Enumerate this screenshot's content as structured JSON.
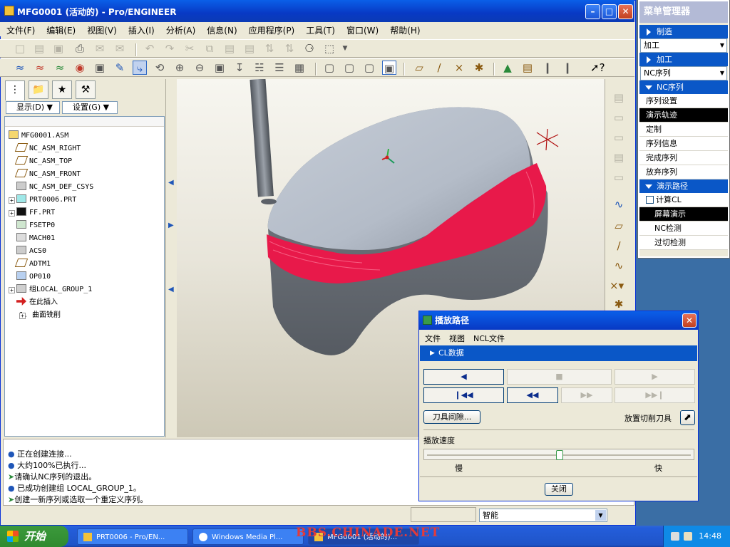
{
  "window": {
    "title": "MFG0001 (活动的) - Pro/ENGINEER"
  },
  "menubar": [
    "文件(F)",
    "编辑(E)",
    "视图(V)",
    "插入(I)",
    "分析(A)",
    "信息(N)",
    "应用程序(P)",
    "工具(T)",
    "窗口(W)",
    "帮助(H)"
  ],
  "left_panel": {
    "show_dropdown": "显示(D)",
    "settings_dropdown": "设置(G)",
    "tree": [
      {
        "label": "MFG0001.ASM",
        "level": 0,
        "icon": "assembly-icon",
        "expander": false
      },
      {
        "label": "NC_ASM_RIGHT",
        "level": 1,
        "icon": "datum-plane-icon",
        "expander": false
      },
      {
        "label": "NC_ASM_TOP",
        "level": 1,
        "icon": "datum-plane-icon",
        "expander": false
      },
      {
        "label": "NC_ASM_FRONT",
        "level": 1,
        "icon": "datum-plane-icon",
        "expander": false
      },
      {
        "label": "NC_ASM_DEF_CSYS",
        "level": 1,
        "icon": "csys-icon",
        "expander": false
      },
      {
        "label": "PRT0006.PRT",
        "level": 1,
        "icon": "part-icon",
        "expander": true
      },
      {
        "label": "FF.PRT",
        "level": 1,
        "icon": "workpiece-icon",
        "expander": true
      },
      {
        "label": "FSETP0",
        "level": 1,
        "icon": "fixture-icon",
        "expander": false
      },
      {
        "label": "MACH01",
        "level": 1,
        "icon": "machine-icon",
        "expander": false
      },
      {
        "label": "ACS0",
        "level": 1,
        "icon": "csys-icon",
        "expander": false
      },
      {
        "label": "ADTM1",
        "level": 1,
        "icon": "datum-plane-icon",
        "expander": false
      },
      {
        "label": "OP010",
        "level": 1,
        "icon": "operation-icon",
        "expander": false
      },
      {
        "label": "组LOCAL_GROUP_1",
        "level": 1,
        "icon": "group-icon",
        "expander": true
      },
      {
        "label": "在此插入",
        "level": 1,
        "icon": "insert-here-arrow-icon",
        "expander": false
      },
      {
        "label": "1. 曲面铣削",
        "level": 0,
        "icon": "",
        "expander": true
      }
    ]
  },
  "messages": [
    {
      "icon": "dot",
      "text": "正在创建连接..."
    },
    {
      "icon": "dot",
      "text": "大约100%已执行..."
    },
    {
      "icon": "arrow",
      "text": "请确认NC序列的退出。"
    },
    {
      "icon": "dot",
      "text": "已成功创建组 LOCAL_GROUP_1。"
    },
    {
      "icon": "arrow",
      "text": "创建一新序列或选取一个重定义序列。"
    }
  ],
  "status": {
    "filter": "智能"
  },
  "menu_manager": {
    "title": "菜单管理器",
    "mfg_header": "制造",
    "mfg_select": "加工",
    "machining_header": "加工",
    "machining_select": "NC序列",
    "nc_header": "NC序列",
    "nc_items": [
      "序列设置",
      "演示轨迹",
      "定制",
      "序列信息",
      "完成序列",
      "放弃序列"
    ],
    "nc_active": "演示轨迹",
    "demo_header": "演示路径",
    "demo_checkbox": "计算CL",
    "demo_items": [
      "屏幕演示",
      "NC检测",
      "过切检测"
    ],
    "demo_active": "屏幕演示"
  },
  "playback": {
    "title": "播放路径",
    "menu": [
      "文件",
      "视图",
      "NCL文件"
    ],
    "cl_bar": "CL数据",
    "tool_clearance": "刀具间隙...",
    "place_tool": "放置切削刀具",
    "speed_label": "播放速度",
    "slow": "慢",
    "fast": "快",
    "speed": 0.5,
    "close": "关闭"
  },
  "taskbar": {
    "start": "开始",
    "tasks": [
      "PRT0006 - Pro/EN...",
      "Windows Media Pl...",
      "MFG0001 (活动的)..."
    ],
    "time": "14:48",
    "watermark": "BBS.CHINADE.NET"
  }
}
